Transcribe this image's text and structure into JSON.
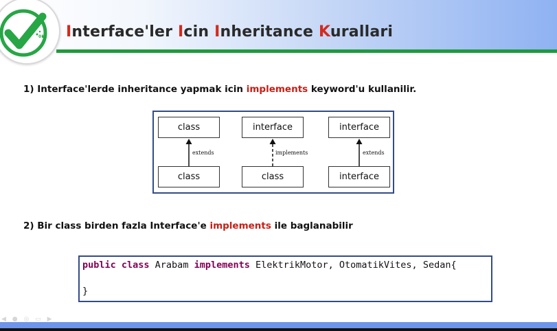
{
  "header": {
    "title_parts": [
      {
        "cap": "I",
        "rest": "nterface'ler "
      },
      {
        "cap": "I",
        "rest": "cin "
      },
      {
        "cap": "I",
        "rest": "nheritance "
      },
      {
        "cap": "K",
        "rest": "urallari"
      }
    ],
    "logo_icon": "checkmark-logo-icon",
    "logo_text": "01"
  },
  "points": [
    {
      "before": "1) Interface'lerde inheritance yapmak icin ",
      "keyword": "implements",
      "after": " keyword'u kullanilir."
    },
    {
      "before": "2) Bir class birden fazla Interface'e ",
      "keyword": "implements",
      "after": " ile baglanabilir"
    }
  ],
  "diagram": {
    "columns": [
      {
        "top": "class",
        "bottom": "class",
        "relation": "extends",
        "dashed": false
      },
      {
        "top": "interface",
        "bottom": "class",
        "relation": "implements",
        "dashed": true
      },
      {
        "top": "interface",
        "bottom": "interface",
        "relation": "extends",
        "dashed": false
      }
    ]
  },
  "code": {
    "kw1": "public class",
    "name": " Arabam ",
    "kw2": "implements",
    "rest": " ElektrikMotor, OtomatikVites, Sedan{",
    "close": "}"
  },
  "colors": {
    "accent_red": "#d42a1e",
    "green_line": "#1f9a3c",
    "box_border": "#324b87"
  }
}
